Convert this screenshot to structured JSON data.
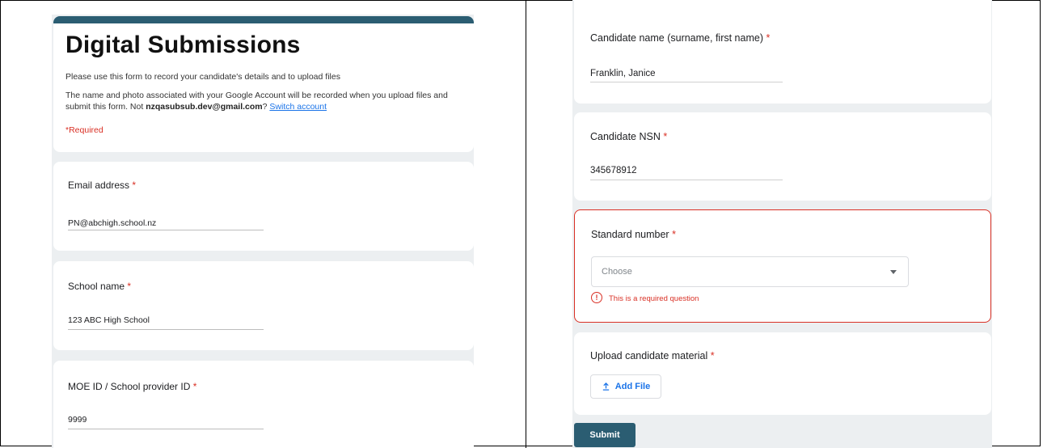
{
  "form": {
    "title": "Digital Submissions",
    "description": "Please use this form to record your candidate's details and to upload files",
    "account_notice_pre": "The name and photo associated with your Google Account will be recorded when you upload files and submit this form. Not ",
    "account_email": "nzqasubsub.dev@gmail.com",
    "account_notice_post": "? ",
    "switch_account": "Switch account",
    "required_note": "*Required"
  },
  "left_questions": [
    {
      "label": "Email address",
      "required_mark": "*",
      "value": "PN@abchigh.school.nz"
    },
    {
      "label": "School name",
      "required_mark": "*",
      "value": "123 ABC High School"
    },
    {
      "label": "MOE ID / School provider ID",
      "required_mark": "*",
      "value": "9999"
    }
  ],
  "right_questions": [
    {
      "label": "Candidate name (surname, first name)",
      "required_mark": "*",
      "value": "Franklin, Janice"
    },
    {
      "label": "Candidate NSN",
      "required_mark": "*",
      "value": "345678912"
    },
    {
      "label": "Standard number",
      "required_mark": "*",
      "placeholder": "Choose",
      "error": "This is a required question"
    },
    {
      "label": "Upload candidate material",
      "required_mark": "*",
      "button": "Add File"
    }
  ],
  "submit_label": "Submit",
  "icons": {
    "error": "error-circle-icon",
    "upload": "upload-icon",
    "dropdown": "dropdown-arrow-icon"
  },
  "colors": {
    "accent": "#2b5d72",
    "error": "#d93025",
    "link": "#1a73e8",
    "background": "#eceff1"
  }
}
